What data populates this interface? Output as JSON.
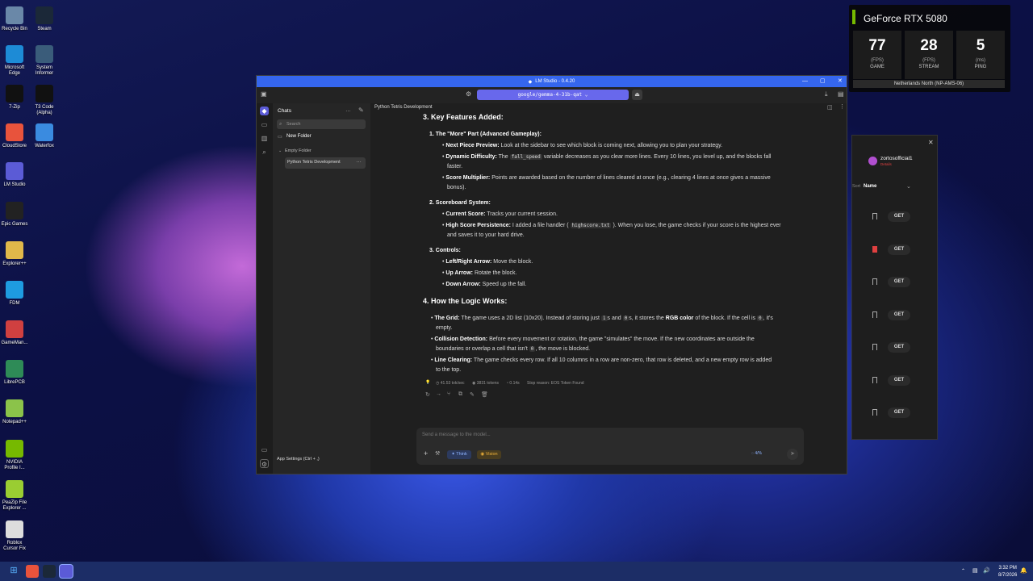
{
  "desktop": {
    "icons": [
      {
        "label": "Recycle Bin",
        "color": "#6a88a8"
      },
      {
        "label": "Steam",
        "color": "#1b2838"
      },
      {
        "label": "Microsoft Edge",
        "color": "#1d8bd6"
      },
      {
        "label": "System Informer",
        "color": "#3a5c7a"
      },
      {
        "label": "7-Zip",
        "color": "#111111"
      },
      {
        "label": "T3 Code (Alpha)",
        "color": "#111111"
      },
      {
        "label": "CloudStore",
        "color": "#e8533c"
      },
      {
        "label": "Waterfox",
        "color": "#3a8be0"
      },
      {
        "label": "LM Studio",
        "color": "#5b5bd6"
      },
      {
        "label": "Epic Games",
        "color": "#222222"
      },
      {
        "label": "Explorer++",
        "color": "#e0b84a"
      },
      {
        "label": "FDM",
        "color": "#1e9be0"
      },
      {
        "label": "GameMan...",
        "color": "#d04040"
      },
      {
        "label": "LibrePCB",
        "color": "#2e8b57"
      },
      {
        "label": "Notepad++",
        "color": "#8bc34a"
      },
      {
        "label": "NVIDIA Profile I...",
        "color": "#76b900"
      },
      {
        "label": "PeaZip File Explorer ...",
        "color": "#9acd32"
      },
      {
        "label": "Roblox Cursor Fix",
        "color": "#dddddd"
      }
    ]
  },
  "overlay": {
    "title": "GeForce RTX 5080",
    "accent": "#76b900",
    "stats": [
      {
        "value": "77",
        "unit": "(FPS)",
        "label": "GAME"
      },
      {
        "value": "28",
        "unit": "(FPS)",
        "label": "STREAM"
      },
      {
        "value": "5",
        "unit": "(ms)",
        "label": "PING"
      }
    ],
    "region": "Netherlands North (NP-AMS-06)"
  },
  "store_window": {
    "user": "zortosofficial1",
    "user_sub": "Details",
    "sort_label": "Sort",
    "column": "Name",
    "get_label": "GET",
    "rows": 7
  },
  "lm": {
    "title": "LM Studio - 0.4.20",
    "model": "google/gemma-4-31b-qat",
    "chat_title": "Python Tetris Development",
    "sidebar": {
      "chats_label": "Chats",
      "search_placeholder": "Search",
      "new_folder": "New Folder",
      "folder": "Empty Folder",
      "active_chat": "Python Tetris Development",
      "app_settings": "App Settings (Ctrl + ,)"
    },
    "message": {
      "h_features": "3. Key Features Added:",
      "s1": "1. The \"More\" Part (Advanced Gameplay):",
      "b1_t": "Next Piece Preview:",
      "b1": "Look at the sidebar to see which block is coming next, allowing you to plan your strategy.",
      "b2_t": "Dynamic Difficulty:",
      "b2_a": "The",
      "b2_code": "fall_speed",
      "b2_b": "variable decreases as you clear more lines. Every 10 lines, you level up, and the blocks fall",
      "b2_c": "faster.",
      "b3_t": "Score Multiplier:",
      "b3": "Points are awarded based on the number of lines cleared at once (e.g., clearing 4 lines at once gives a massive",
      "b3_c": "bonus).",
      "s2": "2. Scoreboard System:",
      "b4_t": "Current Score:",
      "b4": "Tracks your current session.",
      "b5_t": "High Score Persistence:",
      "b5_a": "I added a file handler (",
      "b5_code": "highscore.txt",
      "b5_b": "). When you lose, the game checks if your score is the highest ever",
      "b5_c": "and saves it to your hard drive.",
      "s3": "3. Controls:",
      "b6_t": "Left/Right Arrow:",
      "b6": "Move the block.",
      "b7_t": "Up Arrow:",
      "b7": "Rotate the block.",
      "b8_t": "Down Arrow:",
      "b8": "Speed up the fall.",
      "h_logic": "4. How the Logic Works:",
      "l1_t": "The Grid:",
      "l1_a": "The game uses a 2D list (10x20). Instead of storing just",
      "l1_c1": "1",
      "l1_m": "s and",
      "l1_c2": "0",
      "l1_b": "s, it stores the",
      "l1_bold": "RGB color",
      "l1_c": "of the block. If the cell is",
      "l1_c3": "0",
      "l1_d": ", it's",
      "l1_e": "empty.",
      "l2_t": "Collision Detection:",
      "l2": "Before every movement or rotation, the game \"simulates\" the move. If the new coordinates are outside the",
      "l2_b": "boundaries or overlap a cell that isn't",
      "l2_code": "0",
      "l2_c": ", the move is blocked.",
      "l3_t": "Line Clearing:",
      "l3": "The game checks every row. If all 10 columns in a row are non-zero, that row is deleted, and a new empty row is added",
      "l3_b": "to the top."
    },
    "stats": {
      "speed": "41.53 tok/sec",
      "tokens": "3831 tokens",
      "time": "0.14s",
      "stop": "Stop reason: EOS Token Found"
    },
    "input": {
      "placeholder": "Send a message to the model...",
      "think": "Think",
      "vision": "Vision",
      "context": "4/%"
    }
  },
  "taskbar": {
    "time": "3:32 PM",
    "date": "8/7/2026"
  }
}
